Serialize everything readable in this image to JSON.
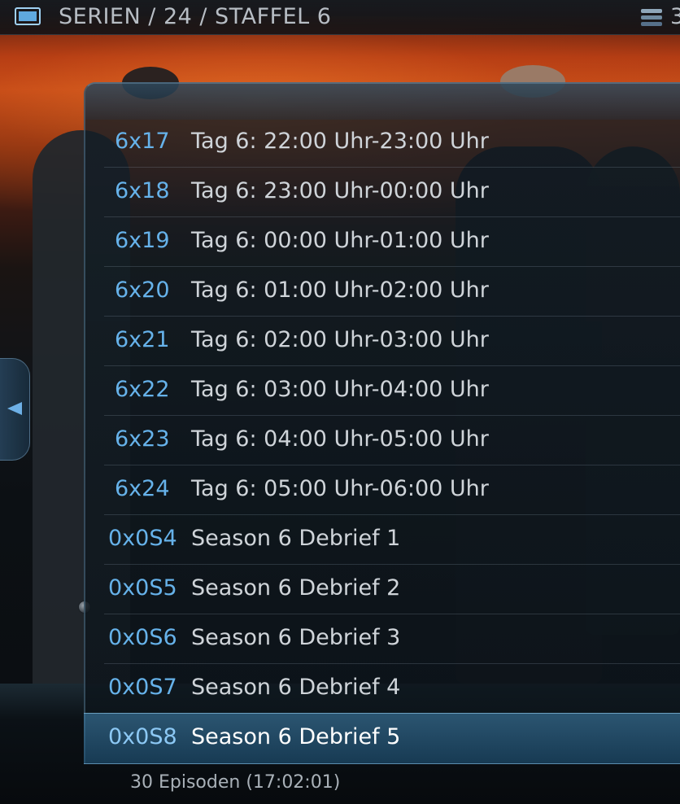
{
  "header": {
    "breadcrumb": "SERIEN / 24  / STAFFEL 6",
    "right_clipped": "3",
    "tv_icon": "tv-icon",
    "sort_icon": "list-stack-icon"
  },
  "side_tab": {
    "icon": "arrow-left-icon"
  },
  "episodes": [
    {
      "num": "6x17",
      "title": "Tag 6: 22:00 Uhr-23:00 Uhr"
    },
    {
      "num": "6x18",
      "title": "Tag 6: 23:00 Uhr-00:00 Uhr"
    },
    {
      "num": "6x19",
      "title": "Tag 6: 00:00 Uhr-01:00 Uhr"
    },
    {
      "num": "6x20",
      "title": "Tag 6: 01:00 Uhr-02:00 Uhr"
    },
    {
      "num": "6x21",
      "title": "Tag 6: 02:00 Uhr-03:00 Uhr"
    },
    {
      "num": "6x22",
      "title": "Tag 6: 03:00 Uhr-04:00 Uhr"
    },
    {
      "num": "6x23",
      "title": "Tag 6: 04:00 Uhr-05:00 Uhr"
    },
    {
      "num": "6x24",
      "title": "Tag 6: 05:00 Uhr-06:00 Uhr"
    },
    {
      "num": "0x0S4",
      "title": "Season 6 Debrief 1"
    },
    {
      "num": "0x0S5",
      "title": "Season 6 Debrief 2"
    },
    {
      "num": "0x0S6",
      "title": "Season 6 Debrief 3"
    },
    {
      "num": "0x0S7",
      "title": "Season 6 Debrief 4"
    },
    {
      "num": "0x0S8",
      "title": "Season 6 Debrief 5",
      "selected": true
    }
  ],
  "footer": {
    "summary": "30 Episoden (17:02:01)"
  },
  "colors": {
    "accent": "#66b2ea",
    "selected_bg": "#2f6f9a",
    "text": "#cfd4d9"
  }
}
